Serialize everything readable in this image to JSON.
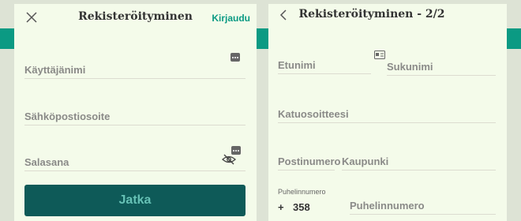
{
  "screen1": {
    "title": "Rekisteröityminen",
    "login_link": "Kirjaudu",
    "fields": {
      "username": "Käyttäjänimi",
      "email": "Sähköpostiosoite",
      "password": "Salasana"
    },
    "continue_label": "Jatka"
  },
  "screen2": {
    "title": "Rekisteröityminen - 2/2",
    "fields": {
      "first_name": "Etunimi",
      "last_name": "Sukunimi",
      "street": "Katuosoitteesi",
      "postal": "Postinumero",
      "city": "Kaupunki",
      "phone_label": "Puhelinnumero",
      "phone_plus": "+",
      "country_code": "358",
      "phone_placeholder": "Puhelinnumero"
    }
  },
  "colors": {
    "accent": "#0b9a83",
    "button": "#0e5a58",
    "panel": "#f4fbea"
  }
}
